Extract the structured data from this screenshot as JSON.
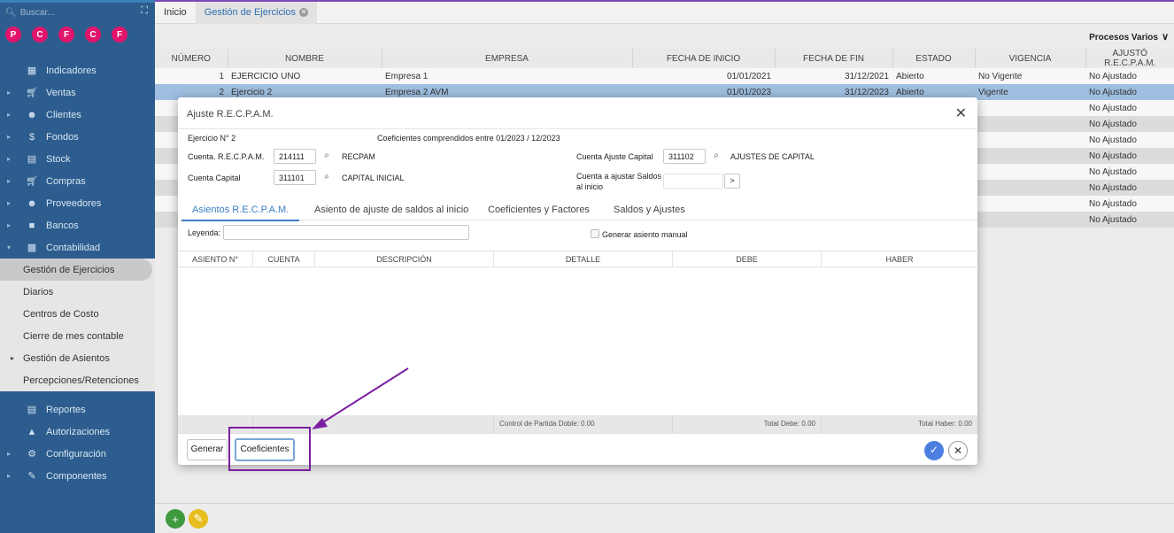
{
  "sidebar": {
    "search_placeholder": "Buscar...",
    "circles": [
      {
        "letter": "P",
        "color": "#e0156b"
      },
      {
        "letter": "C",
        "color": "#e0156b"
      },
      {
        "letter": "F",
        "color": "#e0156b"
      },
      {
        "letter": "C",
        "color": "#e0156b"
      },
      {
        "letter": "F",
        "color": "#e0156b"
      }
    ],
    "items": [
      {
        "label": "Indicadores",
        "icon": "grid-icon"
      },
      {
        "label": "Ventas",
        "icon": "cart-icon"
      },
      {
        "label": "Clientes",
        "icon": "users-icon"
      },
      {
        "label": "Fondos",
        "icon": "dollar-icon"
      },
      {
        "label": "Stock",
        "icon": "box-icon"
      },
      {
        "label": "Compras",
        "icon": "cart-remove-icon"
      },
      {
        "label": "Proveedores",
        "icon": "users-icon"
      },
      {
        "label": "Bancos",
        "icon": "bank-icon"
      },
      {
        "label": "Contabilidad",
        "icon": "book-icon"
      }
    ],
    "sub_items": [
      {
        "label": "Gestión de Ejercicios"
      },
      {
        "label": "Diarios"
      },
      {
        "label": "Centros de Costo"
      },
      {
        "label": "Cierre de mes contable"
      },
      {
        "label": "Gestión de Asientos"
      },
      {
        "label": "Percepciones/Retenciones"
      }
    ],
    "items_after": [
      {
        "label": "Reportes",
        "icon": "report-icon"
      },
      {
        "label": "Autorizaciones",
        "icon": "lock-icon"
      },
      {
        "label": "Configuración",
        "icon": "gears-icon"
      },
      {
        "label": "Componentes",
        "icon": "pencil-icon"
      }
    ]
  },
  "tabs": {
    "home": "Inicio",
    "active": "Gestión de Ejercicios"
  },
  "main": {
    "procesos": "Procesos Varios",
    "columns": [
      "NÚMERO",
      "NOMBRE",
      "EMPRESA",
      "FECHA DE INICIO",
      "FECHA DE FIN",
      "ESTADO",
      "VIGENCIA",
      "AJUSTÓ R.E.C.P.A.M."
    ],
    "rows": [
      {
        "numero": "1",
        "nombre": "EJERCICIO UNO",
        "empresa": "Empresa 1",
        "inicio": "01/01/2021",
        "fin": "31/12/2021",
        "estado": "Abierto",
        "vigencia": "No Vigente",
        "ajusto": "No Ajustado"
      },
      {
        "numero": "2",
        "nombre": "Ejercicio 2",
        "empresa": "Empresa 2 AVM",
        "inicio": "01/01/2023",
        "fin": "31/12/2023",
        "estado": "Abierto",
        "vigencia": "Vigente",
        "ajusto": "No Ajustado"
      }
    ],
    "extra_ajusto": [
      "No Ajustado",
      "No Ajustado",
      "No Ajustado",
      "No Ajustado",
      "No Ajustado",
      "No Ajustado",
      "No Ajustado",
      "No Ajustado"
    ]
  },
  "modal": {
    "title": "Ajuste R.E.C.P.A.M.",
    "ejercicio": "Ejercicio N° 2",
    "coeficientes_rango": "Coeficientes comprendidos entre 01/2023 / 12/2023",
    "cuenta_recpam_label": "Cuenta. R.E.C.P.A.M.",
    "cuenta_recpam_value": "214111",
    "cuenta_recpam_desc": "RECPAM",
    "cuenta_capital_label": "Cuenta Capital",
    "cuenta_capital_value": "311101",
    "cuenta_capital_desc": "CAPITAL INICIAL",
    "cuenta_ajuste_label": "Cuenta Ajuste Capital",
    "cuenta_ajuste_value": "311102",
    "cuenta_ajuste_desc": "AJUSTES DE CAPITAL",
    "cuenta_saldos_label_1": "Cuenta a ajustar Saldos",
    "cuenta_saldos_label_2": "al inicio",
    "cuenta_saldos_btn": ">",
    "tabs": [
      "Asientos R.E.C.P.A.M.",
      "Asiento de ajuste de saldos al inicio",
      "Coeficientes y Factores",
      "Saldos y Ajustes"
    ],
    "leyenda_label": "Leyenda:",
    "generar_manual": "Generar asiento manual",
    "columns": [
      "ASIENTO N°",
      "CUENTA",
      "DESCRIPCIÓN",
      "DETALLE",
      "DEBE",
      "HABER"
    ],
    "footer": {
      "control": "Control de Partida Doble: 0.00",
      "debe": "Total Debe: 0.00",
      "haber": "Total Haber: 0.00"
    },
    "buttons": {
      "generar": "Generar",
      "coeficientes": "Coeficientes"
    }
  },
  "colors": {
    "accent": "#3a7fc2",
    "highlight": "#7b1fa2",
    "sidebar": "#2d5d8e",
    "green": "#2a9a2a",
    "red": "#d01818"
  }
}
